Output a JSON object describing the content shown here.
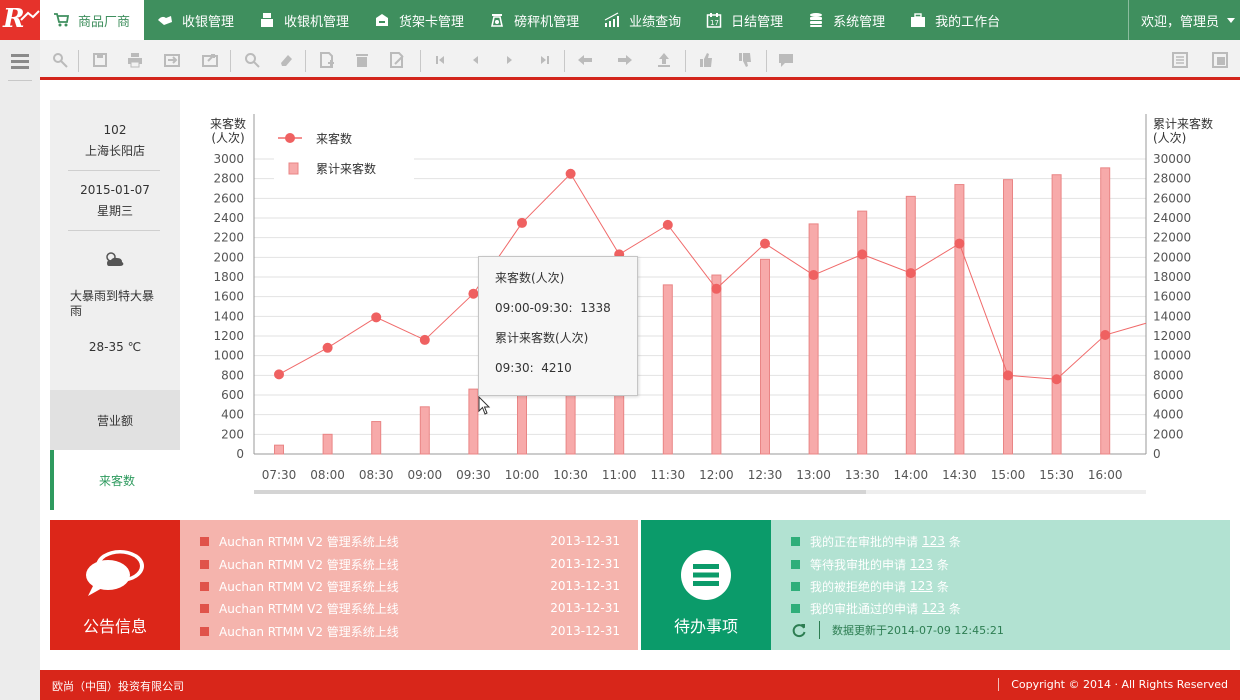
{
  "nav": {
    "items": [
      {
        "label": "商品厂商",
        "icon": "cart-icon"
      },
      {
        "label": "收银管理",
        "icon": "cashier-icon"
      },
      {
        "label": "收银机管理",
        "icon": "register-icon"
      },
      {
        "label": "货架卡管理",
        "icon": "shelf-icon"
      },
      {
        "label": "磅秤机管理",
        "icon": "scale-icon"
      },
      {
        "label": "业绩查询",
        "icon": "growth-icon"
      },
      {
        "label": "日结管理",
        "icon": "calendar-icon"
      },
      {
        "label": "系统管理",
        "icon": "database-icon"
      },
      {
        "label": "我的工作台",
        "icon": "briefcase-icon"
      }
    ],
    "user_greeting": "欢迎，管理员"
  },
  "info": {
    "store_code": "102",
    "store_name": "上海长阳店",
    "date": "2015-01-07",
    "weekday": "星期三",
    "weather": "大暴雨到特大暴雨",
    "temperature": "28-35 ℃"
  },
  "side_tabs": {
    "revenue": "营业额",
    "visitors": "来客数"
  },
  "colors": {
    "nav_green": "#3f8f5e",
    "accent_red": "#d3261c",
    "line_red": "#ef6a6a",
    "bar_pink": "#f7aaaa"
  },
  "chart_data": {
    "type": "line+bar",
    "categories": [
      "07:30",
      "08:00",
      "08:30",
      "09:00",
      "09:30",
      "10:00",
      "10:30",
      "11:00",
      "11:30",
      "12:00",
      "12:30",
      "13:00",
      "13:30",
      "14:00",
      "14:30",
      "15:00",
      "15:30",
      "16:00"
    ],
    "series": [
      {
        "name": "来客数",
        "type": "line",
        "axis": "left",
        "values": [
          810,
          1080,
          1390,
          1160,
          1630,
          2350,
          2850,
          2030,
          2330,
          1680,
          2140,
          1820,
          2030,
          1840,
          2140,
          800,
          760,
          1210
        ]
      },
      {
        "name": "累计来客数",
        "type": "bar",
        "axis": "right",
        "values": [
          900,
          2000,
          3300,
          4800,
          6600,
          8000,
          10000,
          13000,
          17200,
          18200,
          19800,
          23400,
          24700,
          26200,
          27400,
          27900,
          28400,
          29100
        ]
      }
    ],
    "line_tail_right": 1330,
    "ylabel_left": "来客数\n(人次)",
    "ylabel_right": "累计来客数\n(人次)",
    "ylim_left": [
      0,
      3000
    ],
    "ylim_right": [
      0,
      30000
    ],
    "yticks_left": [
      0,
      200,
      400,
      600,
      800,
      1000,
      1200,
      1400,
      1600,
      1800,
      2000,
      2200,
      2400,
      2600,
      2800,
      3000
    ],
    "yticks_right": [
      0,
      2000,
      4000,
      6000,
      8000,
      10000,
      12000,
      14000,
      16000,
      18000,
      20000,
      22000,
      24000,
      26000,
      28000,
      30000
    ],
    "legend_placement": "top-left",
    "grid": true
  },
  "tooltip": {
    "title1": "来客数(人次)",
    "line1_label": "09:00-09:30:",
    "line1_value": "1338",
    "title2": "累计来客数(人次)",
    "line2_label": "09:30:",
    "line2_value": "4210"
  },
  "announcements": {
    "title": "公告信息",
    "items": [
      {
        "text": "Auchan RTMM V2 管理系统上线",
        "date": "2013-12-31"
      },
      {
        "text": "Auchan RTMM V2 管理系统上线",
        "date": "2013-12-31"
      },
      {
        "text": "Auchan RTMM V2 管理系统上线",
        "date": "2013-12-31"
      },
      {
        "text": "Auchan RTMM V2 管理系统上线",
        "date": "2013-12-31"
      },
      {
        "text": "Auchan RTMM V2 管理系统上线",
        "date": "2013-12-31"
      }
    ]
  },
  "todo": {
    "title": "待办事项",
    "items": [
      {
        "pre": "我的正在审批的申请",
        "num": "123",
        "post": "条"
      },
      {
        "pre": "等待我审批的申请",
        "num": "123",
        "post": "条"
      },
      {
        "pre": "我的被拒绝的申请",
        "num": "123",
        "post": "条"
      },
      {
        "pre": "我的审批通过的申请",
        "num": "123",
        "post": "条"
      }
    ],
    "update_text": "数据更新于2014-07-09 12:45:21"
  },
  "footer": {
    "company": "欧尚（中国）投资有限公司",
    "copyright": "Copyright © 2014 · All Rights Reserved"
  }
}
